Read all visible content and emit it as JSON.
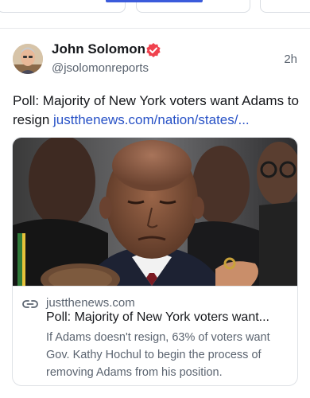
{
  "post": {
    "author_name": "John Solomon",
    "handle": "@jsolomonreports",
    "timestamp": "2h",
    "text": "Poll: Majority of New York voters want Adams to resign ",
    "link_text": "justthenews.com/nation/states/..."
  },
  "link_card": {
    "domain": "justthenews.com",
    "title": "Poll: Majority of New York voters want...",
    "description": "If Adams doesn't resign, 63% of voters want Gov. Kathy Hochul to begin the process of removing Adams from his position."
  },
  "icons": {
    "verified": "verified-badge-icon",
    "link": "link-icon"
  },
  "colors": {
    "link": "#2751c6",
    "verified_badge": "#f0424e",
    "tab_accent": "#3b5bdb"
  }
}
